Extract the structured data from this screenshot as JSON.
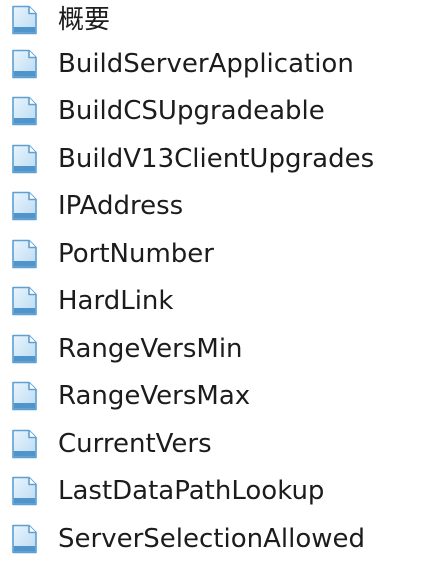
{
  "topics": [
    {
      "label": "概要",
      "icon": "document-icon"
    },
    {
      "label": "BuildServerApplication",
      "icon": "document-icon"
    },
    {
      "label": "BuildCSUpgradeable",
      "icon": "document-icon"
    },
    {
      "label": "BuildV13ClientUpgrades",
      "icon": "document-icon"
    },
    {
      "label": "IPAddress",
      "icon": "document-icon"
    },
    {
      "label": "PortNumber",
      "icon": "document-icon"
    },
    {
      "label": "HardLink",
      "icon": "document-icon"
    },
    {
      "label": "RangeVersMin",
      "icon": "document-icon"
    },
    {
      "label": "RangeVersMax",
      "icon": "document-icon"
    },
    {
      "label": "CurrentVers",
      "icon": "document-icon"
    },
    {
      "label": "LastDataPathLookup",
      "icon": "document-icon"
    },
    {
      "label": "ServerSelectionAllowed",
      "icon": "document-icon"
    }
  ],
  "colors": {
    "icon_fill": "#cfe6f7",
    "icon_border": "#5f9fd1",
    "icon_band": "#4f95cc",
    "text": "#1c1c1c"
  }
}
